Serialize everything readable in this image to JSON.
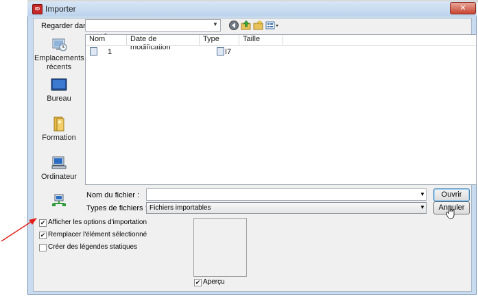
{
  "window": {
    "title": "Importer",
    "app_icon_text": "ID",
    "close_label": "✕"
  },
  "toolbar": {
    "look_in_label": "Regarder dans :",
    "look_in_value": "",
    "icons": [
      "back-icon",
      "up-folder-icon",
      "new-folder-icon",
      "view-menu-icon"
    ]
  },
  "places": [
    {
      "label": "Emplacements récents",
      "icon": "recent-places-icon"
    },
    {
      "label": "Bureau",
      "icon": "desktop-icon"
    },
    {
      "label": "Formation",
      "icon": "library-folder-icon"
    },
    {
      "label": "Ordinateur",
      "icon": "computer-icon"
    },
    {
      "label": "",
      "icon": "network-icon"
    }
  ],
  "filelist": {
    "columns": [
      "Nom",
      "Date de modification",
      "Type",
      "Taille"
    ],
    "rows": [
      {
        "name": "1",
        "date": "",
        "type": "I7",
        "size": ""
      }
    ]
  },
  "filename": {
    "label": "Nom du fichier :",
    "value": ""
  },
  "filetype": {
    "label": "Types de fichiers :",
    "value": "Fichiers importables"
  },
  "buttons": {
    "open": "Ouvrir",
    "cancel": "Annuler"
  },
  "options": [
    {
      "label": "Afficher les options d'importation",
      "checked": true
    },
    {
      "label": "Remplacer l'élément sélectionné",
      "checked": true
    },
    {
      "label": "Créer des légendes statiques",
      "checked": false
    }
  ],
  "preview": {
    "label": "Aperçu",
    "checked": true
  },
  "colors": {
    "annotation_arrow": "#e0201a",
    "title_bar": "#c9dcef",
    "close_button": "#c8452f"
  }
}
